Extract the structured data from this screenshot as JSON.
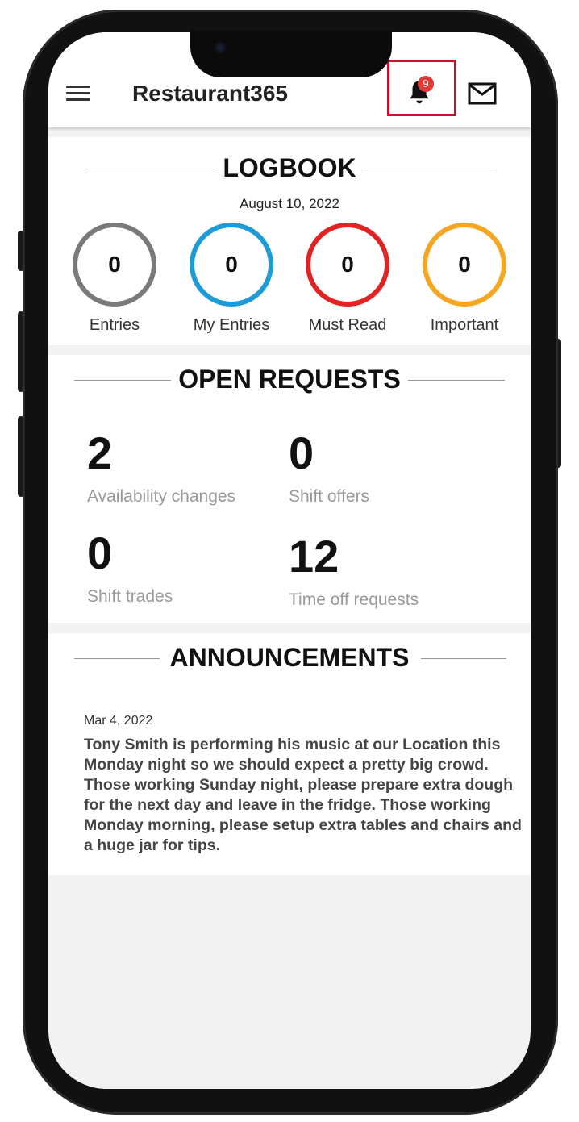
{
  "app": {
    "title": "Restaurant365",
    "notification_count": "9",
    "accent_color": "#c8102e"
  },
  "icons": {
    "menu": "hamburger-menu-icon",
    "notifications": "bell-icon",
    "messages": "mail-icon"
  },
  "logbook": {
    "title": "LOGBOOK",
    "date": "August 10, 2022",
    "stats": [
      {
        "label": "Entries",
        "value": "0",
        "color": "#7a7a7a"
      },
      {
        "label": "My Entries",
        "value": "0",
        "color": "#1e9bd7"
      },
      {
        "label": "Must Read",
        "value": "0",
        "color": "#e02424"
      },
      {
        "label": "Important",
        "value": "0",
        "color": "#f5a623"
      }
    ]
  },
  "open_requests": {
    "title": "OPEN REQUESTS",
    "items": [
      {
        "value": "2",
        "label": "Availability changes"
      },
      {
        "value": "0",
        "label": "Shift offers"
      },
      {
        "value": "0",
        "label": "Shift trades"
      },
      {
        "value": "12",
        "label": "Time off requests"
      }
    ]
  },
  "announcements": {
    "title": "ANNOUNCEMENTS",
    "date": "Mar 4, 2022",
    "body": "Tony Smith is performing his music at our Location this Monday night so we should expect a pretty big crowd. Those working Sunday night, please prepare extra dough for the next day and leave in the fridge.  Those working Monday morning, please setup extra tables and chairs and a huge jar for tips."
  }
}
